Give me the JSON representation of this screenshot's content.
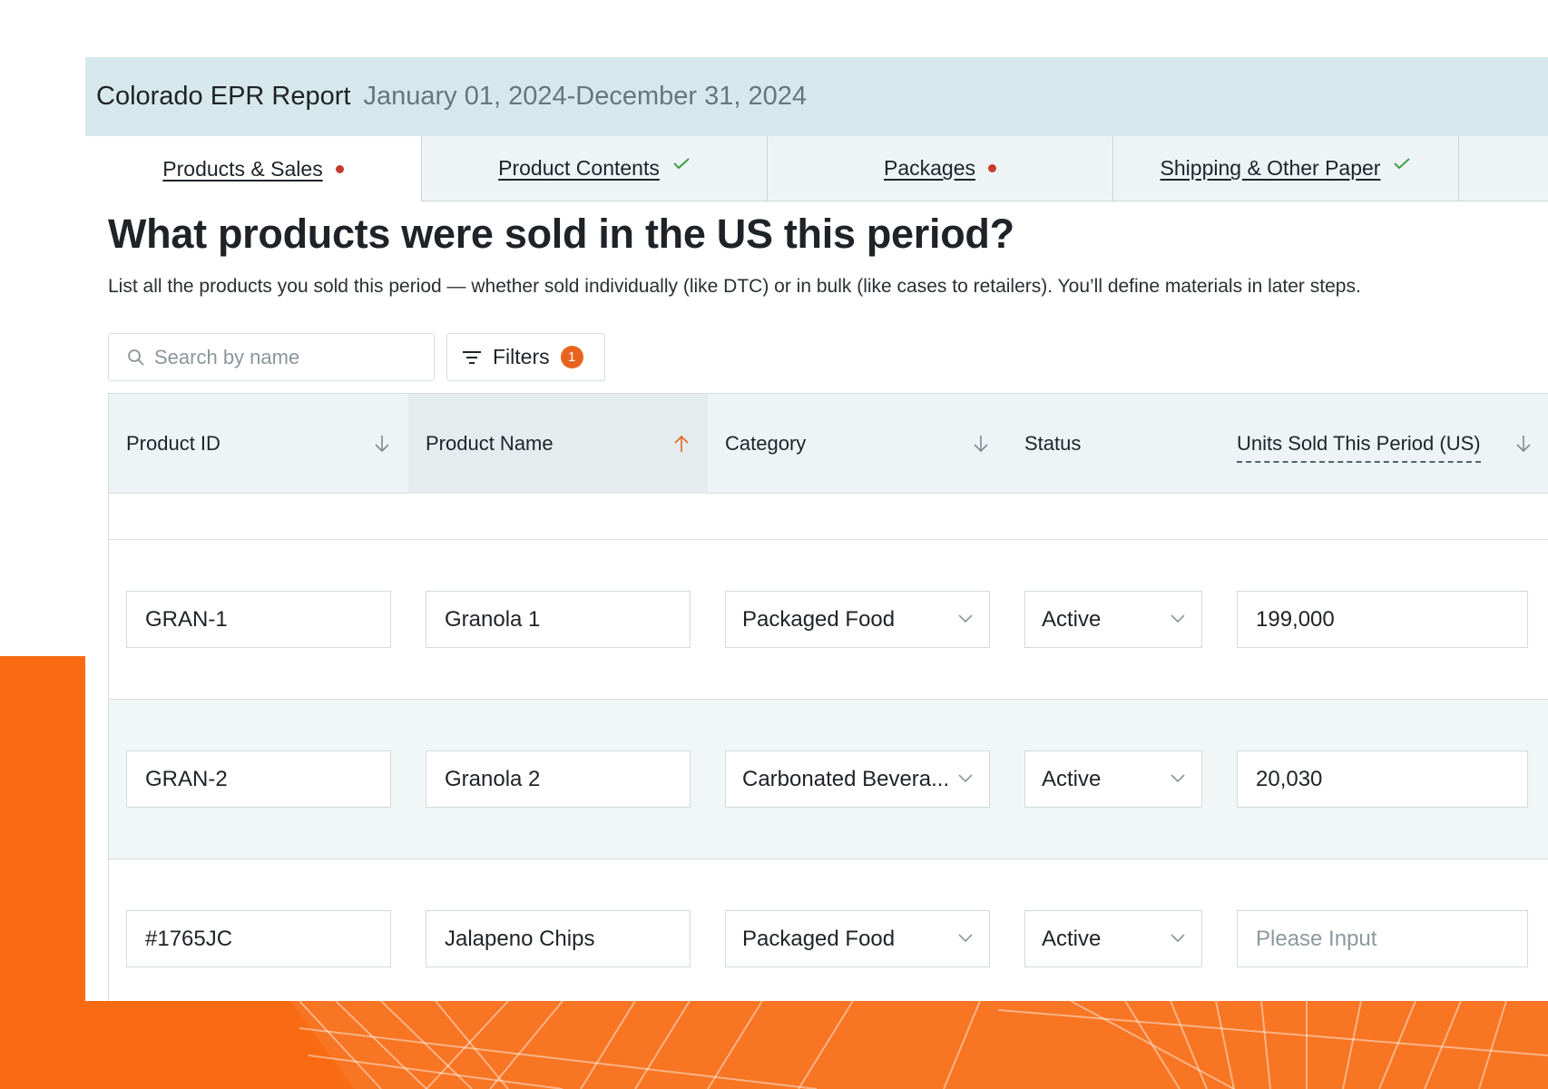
{
  "report": {
    "title": "Colorado EPR Report",
    "period": "January 01, 2024-December 31, 2024"
  },
  "tabs": [
    {
      "label": "Products & Sales",
      "status": "incomplete"
    },
    {
      "label": "Product Contents",
      "status": "complete"
    },
    {
      "label": "Packages",
      "status": "incomplete"
    },
    {
      "label": "Shipping & Other Paper",
      "status": "complete"
    }
  ],
  "page": {
    "title": "What products were sold in the US this period?",
    "description": "List all the products you sold this period — whether sold individually (like DTC) or in bulk (like cases to retailers). You’ll define materials in later steps."
  },
  "toolbar": {
    "search_placeholder": "Search by name",
    "filters_label": "Filters",
    "filters_count": "1"
  },
  "table": {
    "columns": [
      {
        "label": "Product ID",
        "sort": "down"
      },
      {
        "label": "Product Name",
        "sort": "up"
      },
      {
        "label": "Category",
        "sort": "down"
      },
      {
        "label": "Status",
        "sort": "none"
      },
      {
        "label": "Units Sold This Period (US)",
        "sort": "down"
      }
    ],
    "rows": [
      {
        "id": "GRAN-1",
        "name": "Granola 1",
        "category": "Packaged Food",
        "status": "Active",
        "units": "199,000"
      },
      {
        "id": "GRAN-2",
        "name": "Granola 2",
        "category": "Carbonated Bevera...",
        "status": "Active",
        "units": "20,030"
      },
      {
        "id": "#1765JC",
        "name": "Jalapeno Chips",
        "category": "Packaged Food",
        "status": "Active",
        "units": ""
      }
    ],
    "units_placeholder": "Please Input"
  },
  "colors": {
    "accent_orange": "#f86b12",
    "header_bg": "#d6e8ec",
    "status_incomplete": "#c73b2f",
    "status_complete": "#3f9e4a",
    "sort_active": "#e8641e"
  }
}
